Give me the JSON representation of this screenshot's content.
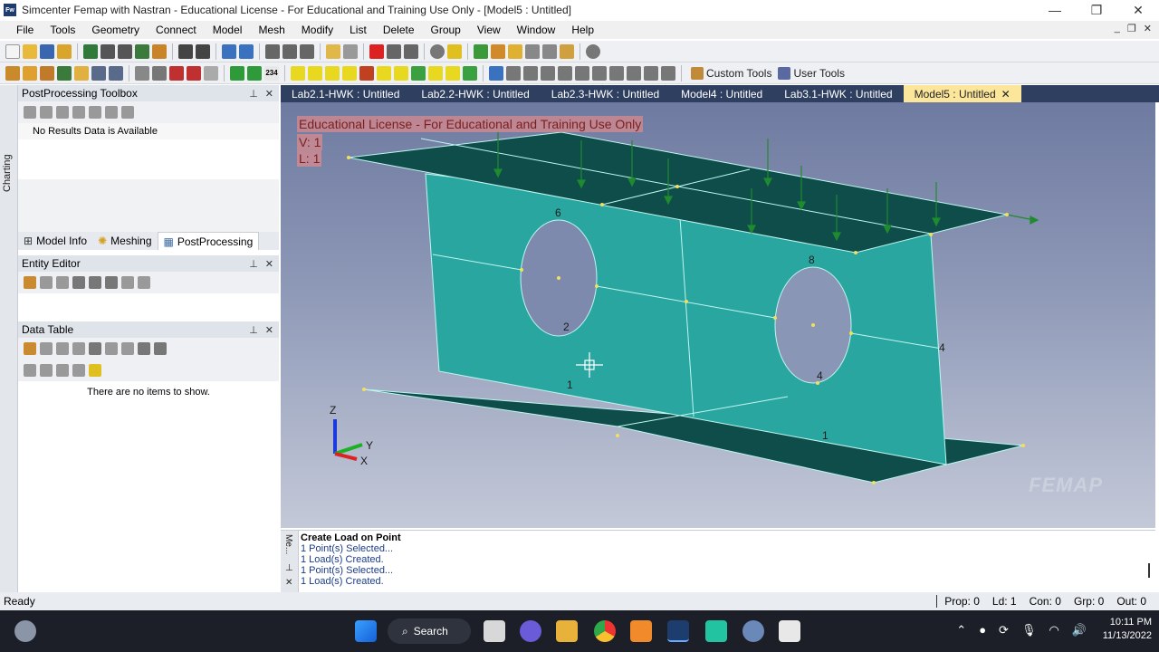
{
  "window": {
    "title": "Simcenter Femap with Nastran - Educational License - For Educational and Training Use Only - [Model5 : Untitled]",
    "icon_text": "Fw",
    "minimize": "—",
    "restore": "❐",
    "close": "✕"
  },
  "menu": {
    "items": [
      "File",
      "Tools",
      "Geometry",
      "Connect",
      "Model",
      "Mesh",
      "Modify",
      "List",
      "Delete",
      "Group",
      "View",
      "Window",
      "Help"
    ]
  },
  "toolbar2": {
    "custom_tools": "Custom Tools",
    "user_tools": "User Tools",
    "counter_label": "234"
  },
  "left_strip": {
    "label": "Charting"
  },
  "postprocessing": {
    "title": "PostProcessing Toolbox",
    "message": "No Results Data is Available"
  },
  "model_tabs": {
    "items": [
      "Model Info",
      "Meshing",
      "PostProcessing"
    ],
    "active": "PostProcessing"
  },
  "entity_editor": {
    "title": "Entity Editor"
  },
  "data_table": {
    "title": "Data Table",
    "empty_message": "There are no items to show."
  },
  "document_tabs": {
    "items": [
      "Lab2.1-HWK : Untitled",
      "Lab2.2-HWK : Untitled",
      "Lab2.3-HWK : Untitled",
      "Model4 : Untitled",
      "Lab3.1-HWK : Untitled",
      "Model5 : Untitled"
    ],
    "active": "Model5 : Untitled",
    "close_glyph": "✕"
  },
  "viewport": {
    "watermark_line1": "Educational License - For Educational and Training Use Only",
    "watermark_line2": "V: 1",
    "watermark_line3": "L: 1",
    "logo": "FEMAP",
    "node_labels": [
      "6",
      "2",
      "8",
      "4",
      "1",
      "1",
      "4"
    ],
    "axis_labels": {
      "z": "Z",
      "y": "Y",
      "x": "X"
    },
    "colors": {
      "web": "#2aa6a0",
      "flange": "#0e4d4a",
      "edge": "#bff6f0",
      "load_arrow": "#1f8a2e"
    }
  },
  "messages": {
    "strip_label": "Me...",
    "lines": [
      "Create Load on Point",
      "1 Point(s) Selected...",
      "1 Load(s) Created.",
      "1 Point(s) Selected...",
      "1 Load(s) Created."
    ]
  },
  "status": {
    "ready": "Ready",
    "prop": "Prop: 0",
    "ld": "Ld: 1",
    "con": "Con: 0",
    "grp": "Grp: 0",
    "out": "Out: 0"
  },
  "taskbar": {
    "search": "Search",
    "time": "10:11 PM",
    "date": "11/13/2022"
  }
}
